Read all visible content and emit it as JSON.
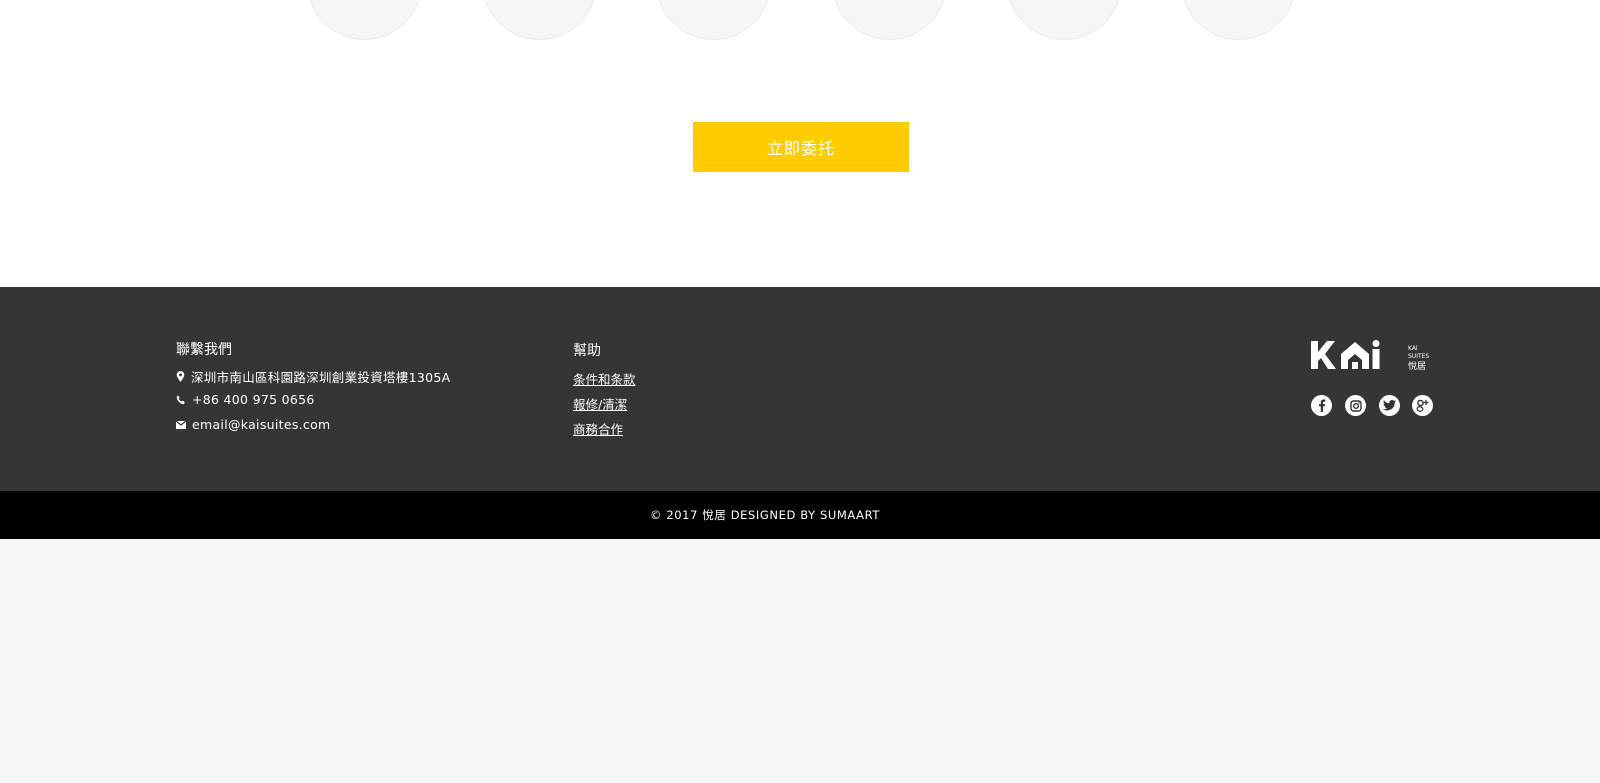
{
  "cta": {
    "label": "立即委托",
    "color": "#ffcc00"
  },
  "footer": {
    "contact": {
      "title": "聯繫我們",
      "address": "深圳市南山區科園路深圳創業投資塔樓1305A",
      "phone": "+86 400 975 0656",
      "email": "email@kaisuites.com"
    },
    "help": {
      "title": "幫助",
      "links": [
        "条件和条款",
        "報修/清潔",
        "商務合作"
      ]
    },
    "logo": {
      "mark": "KAi",
      "text_line1": "KAI",
      "text_line2": "SUITES",
      "text_line3": "悅居"
    },
    "social": [
      "facebook-icon",
      "instagram-icon",
      "twitter-icon",
      "google-plus-icon"
    ],
    "background": "#353535"
  },
  "copyright": "© 2017 悅居 DESIGNED BY SUMAART"
}
